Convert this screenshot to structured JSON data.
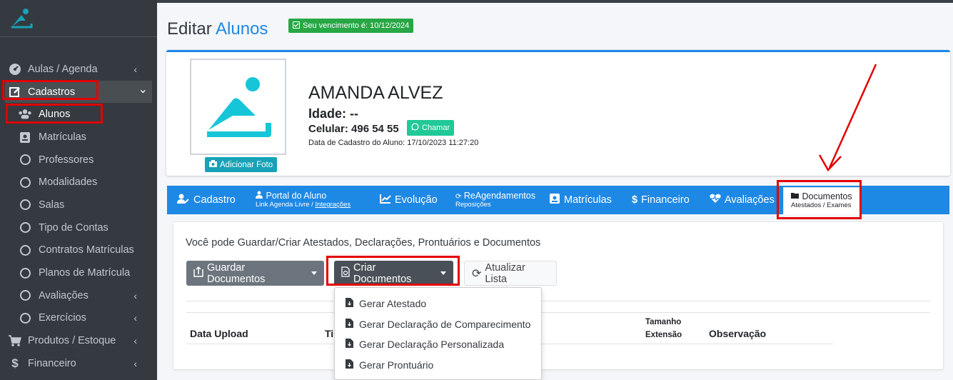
{
  "sidebar": {
    "items": [
      {
        "label": "Aulas / Agenda",
        "icon": "tachometer-icon",
        "level": "top",
        "chevron": "‹"
      },
      {
        "label": "Cadastros",
        "icon": "edit-icon",
        "level": "top",
        "chevron": "⌄"
      },
      {
        "label": "Alunos",
        "icon": "users-icon",
        "level": "sub",
        "chevron": ""
      },
      {
        "label": "Matrículas",
        "icon": "id-badge-icon",
        "level": "sub",
        "chevron": ""
      },
      {
        "label": "Professores",
        "icon": "circle-icon",
        "level": "sub",
        "chevron": ""
      },
      {
        "label": "Modalidades",
        "icon": "circle-icon",
        "level": "sub",
        "chevron": ""
      },
      {
        "label": "Salas",
        "icon": "circle-icon",
        "level": "sub",
        "chevron": ""
      },
      {
        "label": "Tipo de Contas",
        "icon": "circle-icon",
        "level": "sub",
        "chevron": ""
      },
      {
        "label": "Contratos Matrículas",
        "icon": "circle-icon",
        "level": "sub",
        "chevron": ""
      },
      {
        "label": "Planos de Matrícula",
        "icon": "circle-icon",
        "level": "sub",
        "chevron": ""
      },
      {
        "label": "Avaliações",
        "icon": "circle-icon",
        "level": "sub",
        "chevron": "‹"
      },
      {
        "label": "Exercícios",
        "icon": "circle-icon",
        "level": "sub",
        "chevron": "‹"
      },
      {
        "label": "Produtos / Estoque",
        "icon": "cart-icon",
        "level": "top",
        "chevron": "‹"
      },
      {
        "label": "Financeiro",
        "icon": "dollar-icon",
        "level": "top",
        "chevron": "‹"
      }
    ]
  },
  "header": {
    "title_prefix": "Editar",
    "title_accent": "Alunos",
    "due_badge": "Seu vencimento é: 10/12/2024"
  },
  "profile": {
    "name": "AMANDA ALVEZ",
    "age": "Idade: --",
    "phone": "Celular: 496 54 55",
    "chat_label": "Chamar",
    "reg_date": "Data de Cadastro do Aluno: 17/10/2023 11:27:20",
    "add_photo_label": "Adicionar Foto"
  },
  "tabs": [
    {
      "label": "Cadastro",
      "sub": ""
    },
    {
      "label": "Portal do Aluno",
      "sub": "Link Agenda Livre / ",
      "sub_link": "Integrações"
    },
    {
      "label": "Evolução",
      "sub": ""
    },
    {
      "label": "ReAgendamentos",
      "sub": "Reposições"
    },
    {
      "label": "Matrículas",
      "sub": ""
    },
    {
      "label": "Financeiro",
      "sub": ""
    },
    {
      "label": "Avaliações",
      "sub": ""
    },
    {
      "label": "Documentos",
      "sub": "Atestados / Exames"
    }
  ],
  "documents": {
    "info": "Você pode Guardar/Criar Atestados, Declarações, Prontuários e Documentos",
    "guardar_label": "Guardar Documentos",
    "criar_label": "Criar Documentos",
    "atualizar_label": "Atualizar Lista",
    "table_headers": {
      "upload": "Data Upload",
      "tipo": "Ti",
      "tamanho": "Tamanho",
      "extensao": "Extensão",
      "observacao": "Observação"
    },
    "dropdown_items": [
      "Gerar Atestado",
      "Gerar Declaração de Comparecimento",
      "Gerar Declaração Personalizada",
      "Gerar Prontuário"
    ]
  },
  "colors": {
    "primary": "#1e88e5",
    "sidebar": "#343a40",
    "success": "#28a745",
    "annotation": "#e30000",
    "logo": "#17a2b8"
  }
}
